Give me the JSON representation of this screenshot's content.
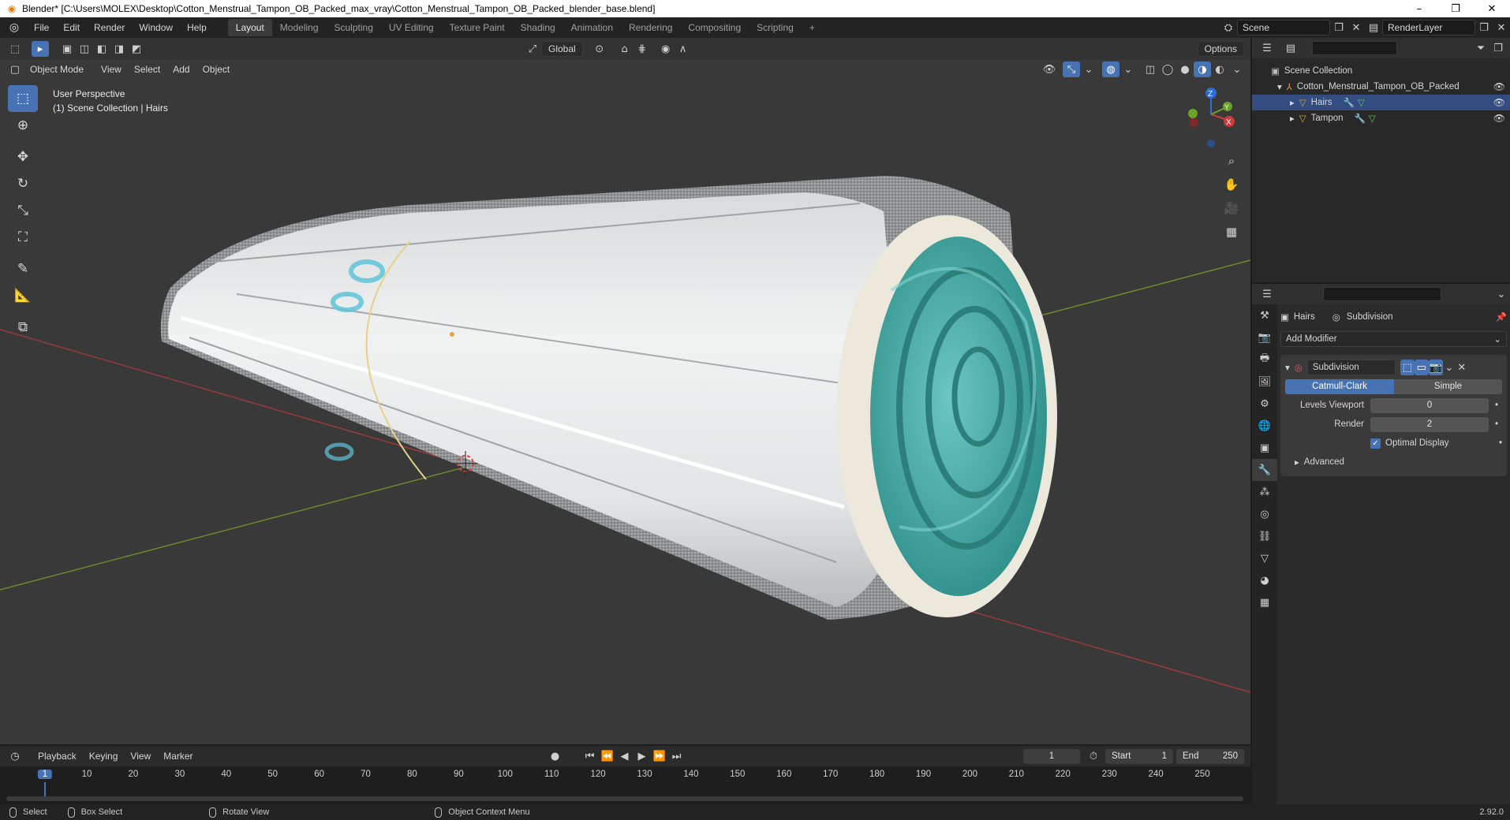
{
  "titlebar": {
    "title": "Blender* [C:\\Users\\MOLEX\\Desktop\\Cotton_Menstrual_Tampon_OB_Packed_max_vray\\Cotton_Menstrual_Tampon_OB_Packed_blender_base.blend]",
    "minimize": "–",
    "maximize": "❐",
    "close": "✕"
  },
  "menubar": {
    "items": [
      "File",
      "Edit",
      "Render",
      "Window",
      "Help"
    ],
    "workspaces": [
      "Layout",
      "Modeling",
      "Sculpting",
      "UV Editing",
      "Texture Paint",
      "Shading",
      "Animation",
      "Rendering",
      "Compositing",
      "Scripting"
    ],
    "add_workspace": "+",
    "scene_label": "Scene",
    "renderlayer_label": "RenderLayer"
  },
  "viewport": {
    "transform_orientation": "Global",
    "options_label": "Options",
    "mode": "Object Mode",
    "menus": [
      "View",
      "Select",
      "Add",
      "Object"
    ],
    "info_line1": "User Perspective",
    "info_line2": "(1) Scene Collection | Hairs",
    "gizmo": {
      "x": "X",
      "y": "Y",
      "z": "Z"
    }
  },
  "outliner": {
    "search_placeholder": "",
    "root": "Scene Collection",
    "collection": "Cotton_Menstrual_Tampon_OB_Packed",
    "objects": [
      "Hairs",
      "Tampon"
    ]
  },
  "properties": {
    "object_name": "Hairs",
    "modifier_breadcrumb": "Subdivision",
    "add_modifier": "Add Modifier",
    "modifier_name": "Subdivision",
    "type_catmull": "Catmull-Clark",
    "type_simple": "Simple",
    "levels_viewport_label": "Levels Viewport",
    "levels_viewport_value": "0",
    "render_label": "Render",
    "render_value": "2",
    "optimal_display_label": "Optimal Display",
    "optimal_display_checked": true,
    "advanced_label": "Advanced"
  },
  "timeline": {
    "menus": [
      "Playback",
      "Keying",
      "View",
      "Marker"
    ],
    "current_frame": "1",
    "start_label": "Start",
    "start_value": "1",
    "end_label": "End",
    "end_value": "250",
    "ticks": [
      "1",
      "10",
      "20",
      "30",
      "40",
      "50",
      "60",
      "70",
      "80",
      "90",
      "100",
      "110",
      "120",
      "130",
      "140",
      "150",
      "160",
      "170",
      "180",
      "190",
      "200",
      "210",
      "220",
      "230",
      "240",
      "250"
    ]
  },
  "statusbar": {
    "select": "Select",
    "box_select": "Box Select",
    "rotate_view": "Rotate View",
    "context_menu": "Object Context Menu",
    "version": "2.92.0"
  },
  "colors": {
    "accent": "#4772b3",
    "x_axis": "#b53b3b",
    "y_axis": "#6b9a26",
    "rope": "#4fb3ae",
    "wrapper": "#e7e9ea"
  }
}
